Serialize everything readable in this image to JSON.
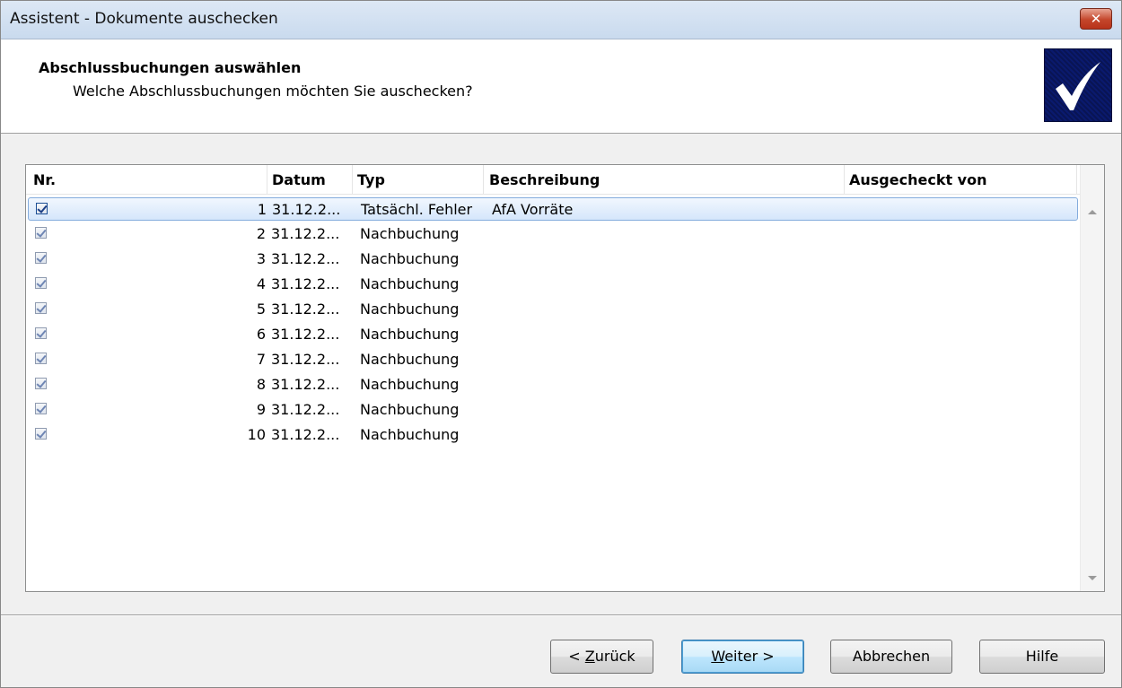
{
  "window": {
    "title": "Assistent - Dokumente auschecken",
    "close_glyph": "✕"
  },
  "header": {
    "title": "Abschlussbuchungen auswählen",
    "subtitle": "Welche Abschlussbuchungen möchten Sie auschecken?",
    "logo_icon": "checkmark-icon"
  },
  "list": {
    "columns": [
      "Nr.",
      "Datum",
      "Typ",
      "Beschreibung",
      "Ausgecheckt von"
    ],
    "rows": [
      {
        "checked": true,
        "nr": "1",
        "datum": "31.12.2...",
        "typ": "Tatsächl. Fehler",
        "beschreibung": "AfA Vorräte",
        "ausgecheckt_von": ""
      },
      {
        "checked": true,
        "nr": "2",
        "datum": "31.12.2...",
        "typ": "Nachbuchung",
        "beschreibung": "",
        "ausgecheckt_von": ""
      },
      {
        "checked": true,
        "nr": "3",
        "datum": "31.12.2...",
        "typ": "Nachbuchung",
        "beschreibung": "",
        "ausgecheckt_von": ""
      },
      {
        "checked": true,
        "nr": "4",
        "datum": "31.12.2...",
        "typ": "Nachbuchung",
        "beschreibung": "",
        "ausgecheckt_von": ""
      },
      {
        "checked": true,
        "nr": "5",
        "datum": "31.12.2...",
        "typ": "Nachbuchung",
        "beschreibung": "",
        "ausgecheckt_von": ""
      },
      {
        "checked": true,
        "nr": "6",
        "datum": "31.12.2...",
        "typ": "Nachbuchung",
        "beschreibung": "",
        "ausgecheckt_von": ""
      },
      {
        "checked": true,
        "nr": "7",
        "datum": "31.12.2...",
        "typ": "Nachbuchung",
        "beschreibung": "",
        "ausgecheckt_von": ""
      },
      {
        "checked": true,
        "nr": "8",
        "datum": "31.12.2...",
        "typ": "Nachbuchung",
        "beschreibung": "",
        "ausgecheckt_von": ""
      },
      {
        "checked": true,
        "nr": "9",
        "datum": "31.12.2...",
        "typ": "Nachbuchung",
        "beschreibung": "",
        "ausgecheckt_von": ""
      },
      {
        "checked": true,
        "nr": "10",
        "datum": "31.12.2...",
        "typ": "Nachbuchung",
        "beschreibung": "",
        "ausgecheckt_von": ""
      }
    ]
  },
  "buttons": {
    "back_prefix": "< ",
    "back_mnemonic": "Z",
    "back_rest": "urück",
    "next_mnemonic": "W",
    "next_rest": "eiter >",
    "cancel": "Abbrechen",
    "help": "Hilfe"
  },
  "colors": {
    "selection_border": "#84acdd",
    "default_button_border": "#3c7fb1",
    "close_button": "#c4462b"
  }
}
